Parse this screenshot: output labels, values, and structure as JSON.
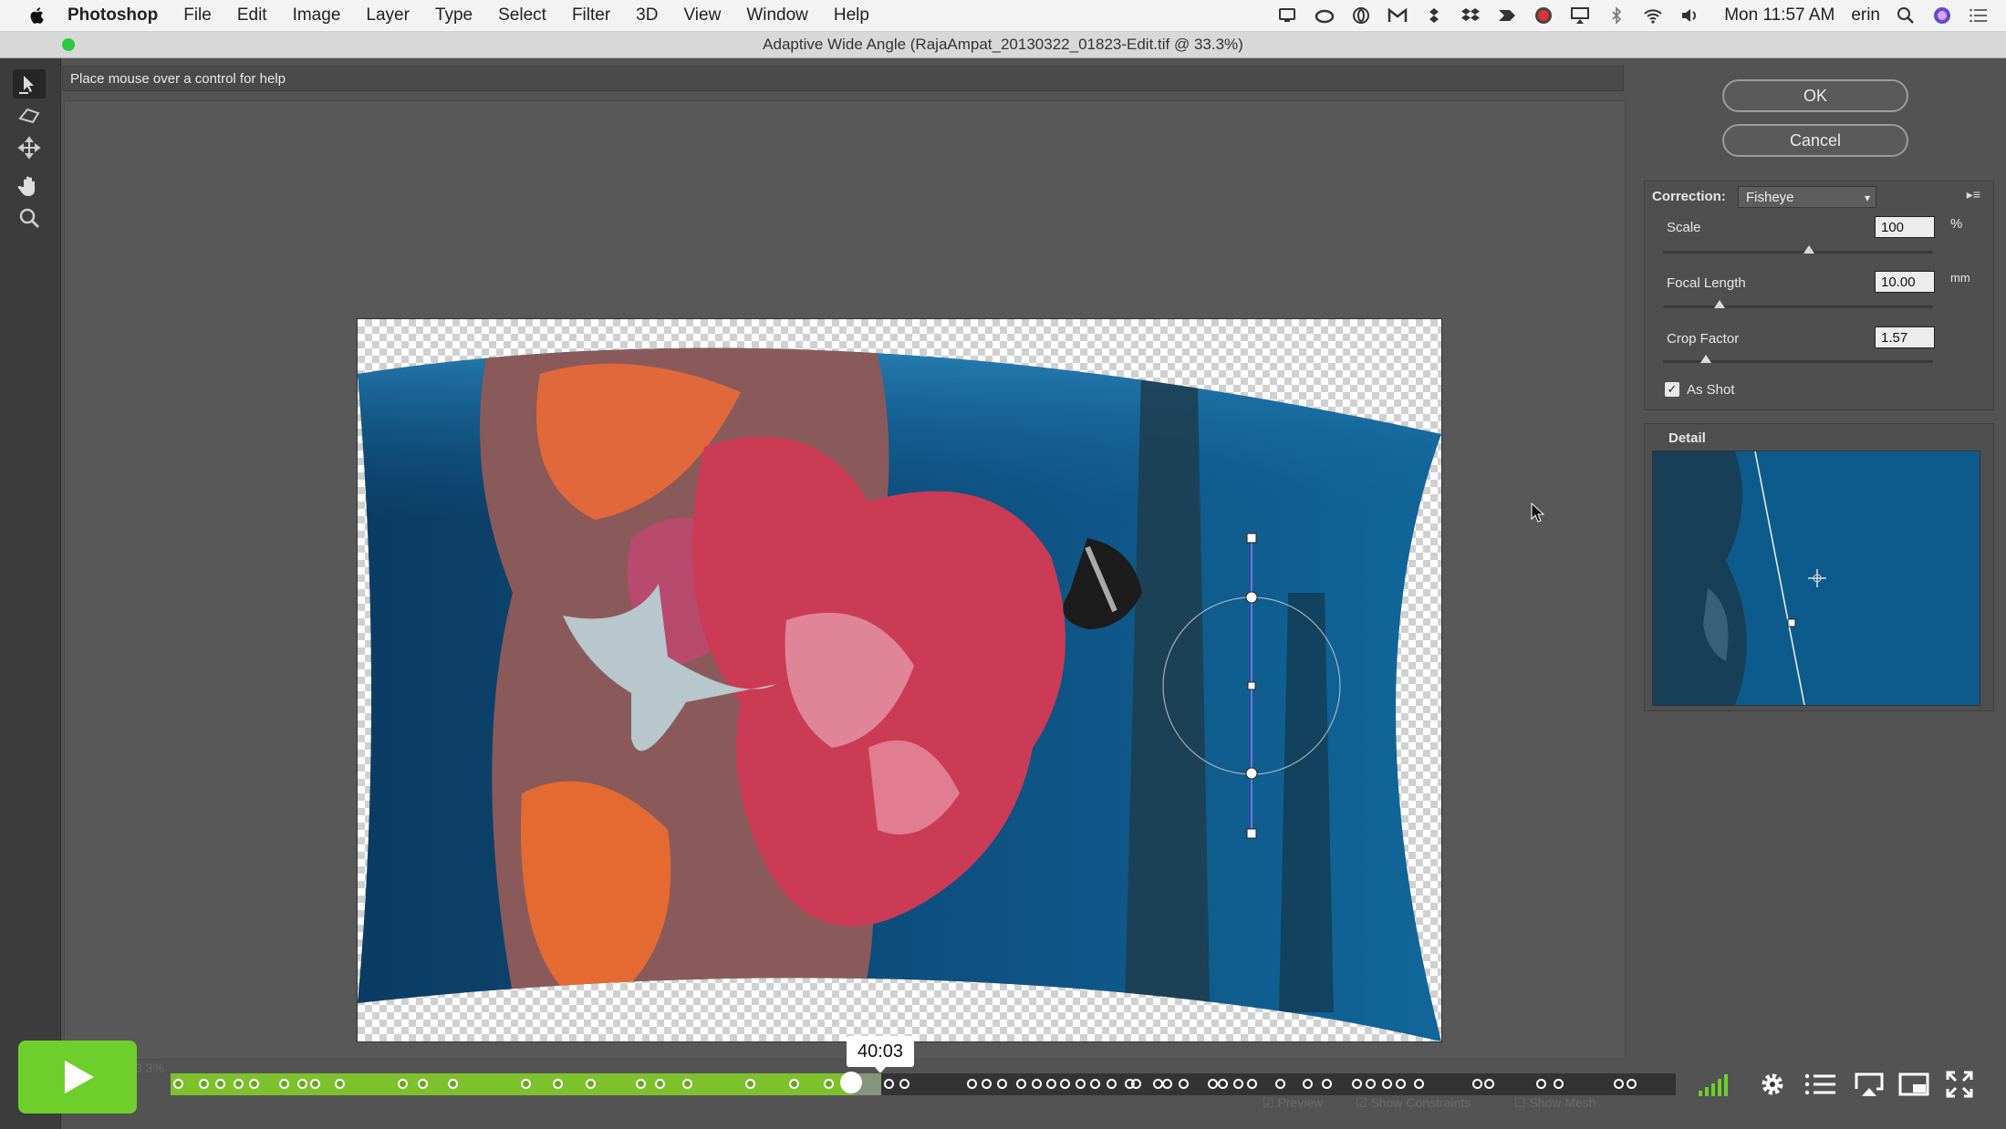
{
  "menubar": {
    "app_name": "Photoshop",
    "items": [
      "File",
      "Edit",
      "Image",
      "Layer",
      "Type",
      "Select",
      "Filter",
      "3D",
      "View",
      "Window",
      "Help"
    ],
    "clock": "Mon 11:57 AM",
    "user": "erin",
    "status_icons": [
      "display-icon",
      "creative-cloud-icon",
      "opera-icon",
      "gmail-icon",
      "dropbox-sync-icon",
      "dropbox-icon",
      "bolt-icon",
      "record-icon",
      "airplay-icon",
      "bluetooth-icon",
      "wifi-icon",
      "volume-icon",
      "spotlight-icon",
      "siri-icon",
      "notification-list-icon"
    ]
  },
  "window": {
    "title": "Adaptive Wide Angle (RajaAmpat_20130322_01823-Edit.tif @ 33.3%)"
  },
  "tools": [
    "constraint-tool-icon",
    "polygon-constraint-tool-icon",
    "move-tool-icon",
    "hand-tool-icon",
    "zoom-tool-icon"
  ],
  "help_text": "Place mouse over a control for help",
  "dialog": {
    "ok_label": "OK",
    "cancel_label": "Cancel",
    "correction_label": "Correction:",
    "correction_value": "Fisheye",
    "correction_options": [
      "Fisheye"
    ],
    "scale": {
      "label": "Scale",
      "value": "100",
      "unit": "%",
      "slider_fraction": 0.54
    },
    "focal_length": {
      "label": "Focal Length",
      "value": "10.00",
      "unit": "mm",
      "slider_fraction": 0.21
    },
    "crop_factor": {
      "label": "Crop Factor",
      "value": "1.57",
      "slider_fraction": 0.16
    },
    "as_shot": {
      "label": "As Shot",
      "checked": true
    },
    "detail_label": "Detail"
  },
  "player": {
    "time_tooltip": "40:03",
    "progress_fraction": 0.452,
    "hover_fraction": 0.472,
    "chapter_marks": [
      0.005,
      0.022,
      0.033,
      0.045,
      0.055,
      0.075,
      0.087,
      0.096,
      0.112,
      0.154,
      0.167,
      0.187,
      0.236,
      0.257,
      0.279,
      0.312,
      0.325,
      0.343,
      0.385,
      0.414,
      0.437,
      0.477,
      0.487,
      0.532,
      0.542,
      0.552,
      0.565,
      0.575,
      0.585,
      0.594,
      0.604,
      0.614,
      0.625,
      0.637,
      0.641,
      0.656,
      0.662,
      0.673,
      0.692,
      0.699,
      0.709,
      0.718,
      0.737,
      0.755,
      0.768,
      0.788,
      0.797,
      0.808,
      0.817,
      0.829,
      0.868,
      0.876,
      0.91,
      0.922,
      0.962,
      0.97
    ]
  }
}
